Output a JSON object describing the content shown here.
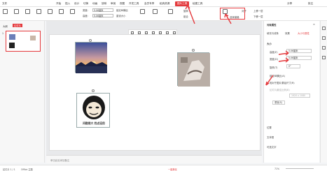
{
  "menubar": {
    "items": [
      "文件",
      "开始",
      "插入",
      "设计",
      "切换",
      "动画",
      "放映",
      "审阅",
      "视图",
      "开发工具",
      "会员专享",
      "稻壳资源",
      "图片工具",
      "绘图工具"
    ],
    "active_index": 12,
    "right": [
      "分享",
      "批注"
    ]
  },
  "ribbon": {
    "width_label": "宽度:",
    "height_label": "高度:",
    "width_value": "5.06厘米",
    "height_value": "5.06厘米",
    "lock_ratio": "锁定纵横比",
    "reset_size": "重设大小",
    "crop": "裁剪",
    "combine": "组合",
    "rotate": "旋转",
    "align": "对齐",
    "select_pane": "选择窗格",
    "up_layer": "上移一层",
    "down_layer": "下移一层"
  },
  "leftpanel": {
    "tabs": [
      "大纲",
      "幻灯片"
    ],
    "slide_number": "1"
  },
  "rightpanel": {
    "title": "对象属性",
    "tabs": [
      "填充与线条",
      "效果",
      "大小与属性"
    ],
    "section_size": "大小",
    "height_label": "高度(E)",
    "width_label": "宽度(D)",
    "rotate_label": "旋转(T)",
    "height_value": "5.06厘米",
    "width_value": "5.06厘米",
    "rotate_value": "0°",
    "lock_ratio": "锁定纵横比(A)",
    "relative_size": "相对于图片原始尺寸(R)",
    "best_scale": "幻灯片最佳比例(B)",
    "resolution": "1920 x 1080",
    "reset": "重设(S)",
    "section_position": "位置",
    "section_text": "文本框",
    "section_alt": "可选文字"
  },
  "canvas": {
    "meme_caption": "问题很大 找点没用",
    "notes_placeholder": "单击此处添加备注"
  },
  "statusbar": {
    "slide_info": "幻灯片 1 / 1",
    "theme": "Office 主题",
    "beautify": "一键美化",
    "zoom": "71%"
  }
}
